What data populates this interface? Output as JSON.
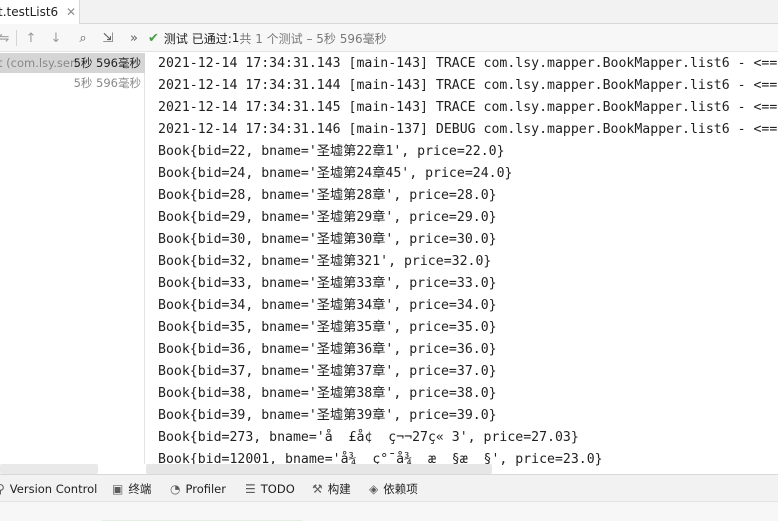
{
  "tab": {
    "label": "t.testList6",
    "close": "✕"
  },
  "toolbar": {
    "icons": [
      "rerun-icon",
      "previous-icon",
      "next-icon",
      "find-icon",
      "export-icon",
      "more-icon"
    ],
    "more_label": "»",
    "status_main": "测试 已通过: ",
    "status_count": "1",
    "status_detail": "共 1 个测试 – 5秒 596毫秒"
  },
  "tree": {
    "rows": [
      {
        "name": "t (com.lsy.sen",
        "time": "5秒 596毫秒"
      },
      {
        "name": "",
        "time": "5秒 596毫秒"
      }
    ]
  },
  "console": {
    "lines": [
      "2021-12-14 17:34:31.143 [main-143] TRACE com.lsy.mapper.BookMapper.list6 - <==",
      "2021-12-14 17:34:31.144 [main-143] TRACE com.lsy.mapper.BookMapper.list6 - <==",
      "2021-12-14 17:34:31.145 [main-143] TRACE com.lsy.mapper.BookMapper.list6 - <==",
      "2021-12-14 17:34:31.146 [main-137] DEBUG com.lsy.mapper.BookMapper.list6 - <==",
      "Book{bid=22, bname='圣墟第22章1', price=22.0}",
      "Book{bid=24, bname='圣墟第24章45', price=24.0}",
      "Book{bid=28, bname='圣墟第28章', price=28.0}",
      "Book{bid=29, bname='圣墟第29章', price=29.0}",
      "Book{bid=30, bname='圣墟第30章', price=30.0}",
      "Book{bid=32, bname='圣墟第321', price=32.0}",
      "Book{bid=33, bname='圣墟第33章', price=33.0}",
      "Book{bid=34, bname='圣墟第34章', price=34.0}",
      "Book{bid=35, bname='圣墟第35章', price=35.0}",
      "Book{bid=36, bname='圣墟第36章', price=36.0}",
      "Book{bid=37, bname='圣墟第37章', price=37.0}",
      "Book{bid=38, bname='圣墟第38章', price=38.0}",
      "Book{bid=39, bname='圣墟第39章', price=39.0}",
      "Book{bid=273, bname='å  £å¢  ç¬¬27ç« 3', price=27.03}",
      "Book{bid=12001, bname='å¾  ç°¯å¾  æ  §æ  §', price=23.0}"
    ]
  },
  "bottom": {
    "tools": [
      {
        "icon": "version-control-icon",
        "glyph": "⚲",
        "label": "Version Control"
      },
      {
        "icon": "terminal-icon",
        "glyph": "▣",
        "label": "终端"
      },
      {
        "icon": "profiler-icon",
        "glyph": "◔",
        "label": "Profiler"
      },
      {
        "icon": "todo-icon",
        "glyph": "☰",
        "label": "TODO"
      },
      {
        "icon": "build-icon",
        "glyph": "⚒",
        "label": "构建"
      },
      {
        "icon": "dependencies-icon",
        "glyph": "◈",
        "label": "依赖项"
      }
    ]
  },
  "colors": {
    "pass_green": "#4a9d45",
    "accent": "#3574f0"
  }
}
